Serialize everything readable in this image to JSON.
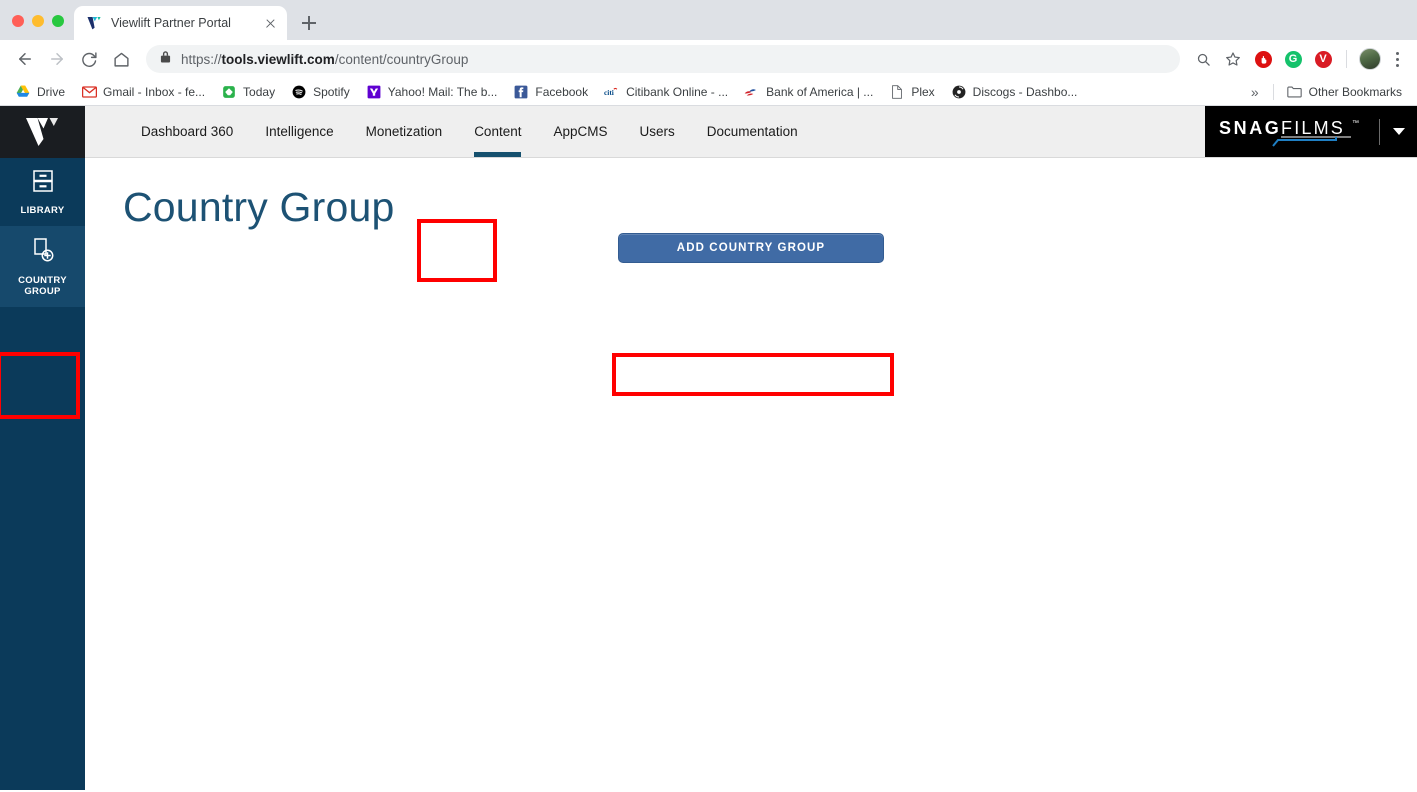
{
  "browser": {
    "tab": {
      "title": "Viewlift Partner Portal",
      "favicon": "viewlift-v-icon",
      "close": "✕"
    },
    "new_tab_label": "+",
    "nav": {
      "back": "back-arrow",
      "forward": "forward-arrow",
      "reload": "reload",
      "home": "home"
    },
    "omnibox": {
      "lock": "lock-icon",
      "scheme": "https://",
      "host": "tools.viewlift.com",
      "path": "/content/countryGroup",
      "full_url": "https://tools.viewlift.com/content/countryGroup"
    },
    "toolbar_icons": [
      {
        "name": "zoom-search-icon",
        "glyph": "⌕"
      },
      {
        "name": "bookmark-star-icon",
        "glyph": "☆"
      },
      {
        "name": "opera-adblock-extension",
        "glyph": "✋",
        "color": "#dd1111"
      },
      {
        "name": "grammarly-extension",
        "glyph": "G",
        "color": "#15c26b"
      },
      {
        "name": "video-downloader-extension",
        "glyph": "V",
        "color": "#d91c25"
      },
      {
        "name": "profile-avatar",
        "glyph": ""
      },
      {
        "name": "chrome-menu-kebab",
        "glyph": "⋮"
      }
    ],
    "bookmarks": [
      {
        "label": "Drive",
        "icon": "google-drive-icon"
      },
      {
        "label": "Gmail - Inbox - fe...",
        "icon": "gmail-icon"
      },
      {
        "label": "Today",
        "icon": "feedly-icon"
      },
      {
        "label": "Spotify",
        "icon": "spotify-icon"
      },
      {
        "label": "Yahoo! Mail: The b...",
        "icon": "yahoo-icon"
      },
      {
        "label": "Facebook",
        "icon": "facebook-icon"
      },
      {
        "label": "Citibank Online - ...",
        "icon": "citi-icon"
      },
      {
        "label": "Bank of America | ...",
        "icon": "bank-of-america-icon"
      },
      {
        "label": "Plex",
        "icon": "document-icon"
      },
      {
        "label": "Discogs - Dashbo...",
        "icon": "discogs-icon"
      }
    ],
    "bookmarks_overflow": "»",
    "other_bookmarks": {
      "label": "Other Bookmarks",
      "icon": "folder-icon"
    }
  },
  "app": {
    "sidebar": {
      "logo": "viewlift-logo",
      "items": [
        {
          "label": "LIBRARY",
          "icon": "filing-cabinet-icon",
          "active": false
        },
        {
          "label": "COUNTRY\nGROUP",
          "label_line1": "COUNTRY",
          "label_line2": "GROUP",
          "icon": "add-document-icon",
          "active": true
        }
      ]
    },
    "topnav": {
      "items": [
        {
          "label": "Dashboard 360",
          "active": false
        },
        {
          "label": "Intelligence",
          "active": false
        },
        {
          "label": "Monetization",
          "active": false
        },
        {
          "label": "Content",
          "active": true
        },
        {
          "label": "AppCMS",
          "active": false
        },
        {
          "label": "Users",
          "active": false
        },
        {
          "label": "Documentation",
          "active": false
        }
      ],
      "brand": {
        "part1": "SNAG",
        "part2": "FILMS",
        "tm": "™",
        "caret": "chevron-down-icon"
      }
    },
    "page": {
      "title": "Country Group",
      "add_button_label": "ADD COUNTRY GROUP"
    }
  },
  "annotations": [
    {
      "name": "content-tab-highlight",
      "color": "#ff0000"
    },
    {
      "name": "country-group-sidebar-highlight",
      "color": "#ff0000"
    },
    {
      "name": "add-country-group-button-highlight",
      "color": "#ff0000"
    }
  ],
  "colors": {
    "sidebar_bg": "#0b3a5a",
    "sidebar_active": "#16496c",
    "topnav_bg": "#efefef",
    "title_blue": "#1d5274",
    "button_blue": "#406ba5",
    "brand_black": "#000000",
    "annotation_red": "#ff0000"
  }
}
